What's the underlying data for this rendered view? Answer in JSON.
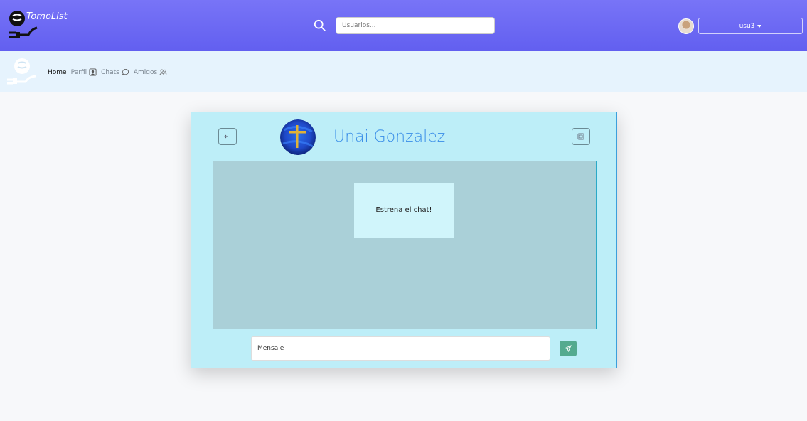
{
  "brand": {
    "name": "TomoList"
  },
  "header": {
    "search_placeholder": "Usuarios...",
    "user_label": "usu3"
  },
  "nav": {
    "items": [
      {
        "label": "Home",
        "icon": "home"
      },
      {
        "label": "Perfil",
        "icon": "person-badge-icon"
      },
      {
        "label": "Chats",
        "icon": "chat-icon"
      },
      {
        "label": "Amigos",
        "icon": "people-icon"
      }
    ]
  },
  "chat": {
    "contact_name": "Unai Gonzalez",
    "empty_message": "Estrena el chat!",
    "input_placeholder": "Mensaje"
  },
  "colors": {
    "header": "#6b68f2",
    "subnav": "#e6f3fd",
    "card": "#bdeef8",
    "message_area": "#aad0d8",
    "send_button": "#54aa8f"
  }
}
